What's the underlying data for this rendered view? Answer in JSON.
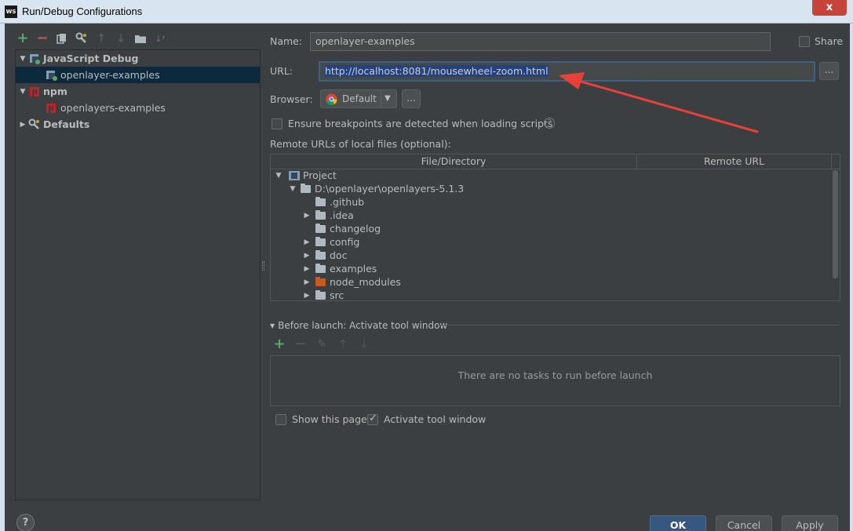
{
  "window": {
    "title": "Run/Debug Configurations",
    "app_icon_text": "WS",
    "close_glyph": "x"
  },
  "left_toolbar": {
    "icons": [
      "plus-icon",
      "minus-icon",
      "copy-icon",
      "wrench-icon",
      "arrow-up-icon",
      "arrow-down-icon",
      "folder-icon",
      "sort-icon"
    ]
  },
  "tree": {
    "items": [
      {
        "label": "JavaScript Debug",
        "level": 0,
        "expanded": true,
        "bold": true,
        "icon": "javascript-debug-icon"
      },
      {
        "label": "openlayer-examples",
        "level": 1,
        "selected": true,
        "icon": "javascript-debug-config-icon"
      },
      {
        "label": "npm",
        "level": 0,
        "expanded": true,
        "bold": true,
        "icon": "npm-icon"
      },
      {
        "label": "openlayers-examples",
        "level": 1,
        "icon": "npm-config-icon"
      },
      {
        "label": "Defaults",
        "level": 0,
        "expanded": false,
        "bold": true,
        "icon": "wrench-icon"
      }
    ]
  },
  "form": {
    "name_label": "Name:",
    "name_value": "openlayer-examples",
    "share_label": "Share",
    "share_checked": false,
    "url_label": "URL:",
    "url_value": "http://localhost:8081/mousewheel-zoom.html",
    "url_browse": "...",
    "browser_label": "Browser:",
    "browser_value": "Default",
    "browser_more": "...",
    "ensure_label": "Ensure breakpoints are detected when loading scripts",
    "ensure_checked": false,
    "help_glyph": "?",
    "remote_label": "Remote URLs of local files (optional):"
  },
  "mapping_table": {
    "columns": [
      "File/Directory",
      "Remote URL"
    ],
    "rows": [
      {
        "label": "Project",
        "indent": 0,
        "arrow": "▼",
        "icon": "project-icon"
      },
      {
        "label": "D:\\openlayer\\openlayers-5.1.3",
        "indent": 1,
        "arrow": "▼",
        "icon": "folder-icon"
      },
      {
        "label": ".github",
        "indent": 2,
        "arrow": "",
        "icon": "folder-icon"
      },
      {
        "label": ".idea",
        "indent": 2,
        "arrow": "▶",
        "icon": "folder-icon"
      },
      {
        "label": "changelog",
        "indent": 2,
        "arrow": "",
        "icon": "folder-icon"
      },
      {
        "label": "config",
        "indent": 2,
        "arrow": "▶",
        "icon": "folder-icon"
      },
      {
        "label": "doc",
        "indent": 2,
        "arrow": "▶",
        "icon": "folder-icon"
      },
      {
        "label": "examples",
        "indent": 2,
        "arrow": "▶",
        "icon": "folder-icon"
      },
      {
        "label": "node_modules",
        "indent": 2,
        "arrow": "▶",
        "icon": "excluded-folder-icon"
      },
      {
        "label": "src",
        "indent": 2,
        "arrow": "▶",
        "icon": "folder-icon"
      }
    ]
  },
  "before_launch": {
    "title": "Before launch: Activate tool window",
    "empty_text": "There are no tasks to run before launch",
    "show_page_label": "Show this page",
    "show_page_checked": false,
    "activate_label": "Activate tool window",
    "activate_checked": true
  },
  "buttons": {
    "ok": "OK",
    "cancel": "Cancel",
    "apply": "Apply",
    "help": "?"
  },
  "colors": {
    "background": "#3c3f41",
    "selection": "#0d293e",
    "accent_blue": "#365880",
    "annotation_arrow": "#e8413a",
    "add_green": "#59a869",
    "remove_red": "#c75450"
  }
}
